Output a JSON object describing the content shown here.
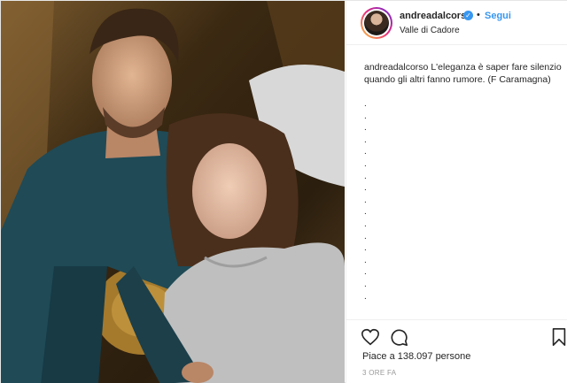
{
  "post": {
    "username": "andreadalcorso",
    "verified_icon": "verified-badge-icon",
    "separator": "•",
    "follow_label": "Segui",
    "location": "Valle di Cadore",
    "caption_user": "andreadalcorso",
    "caption_text": "L'eleganza è saper fare silenzio quando gli altri fanno rumore. (F Caramagna)",
    "caption_dots": [
      ".",
      ".",
      ".",
      ".",
      ".",
      ".",
      ".",
      ".",
      ".",
      ".",
      ".",
      ".",
      ".",
      ".",
      ".",
      ".",
      "."
    ],
    "likes": "Piace a 138.097 persone",
    "timestamp": "3 ORE FA"
  },
  "icons": {
    "like": "heart-icon",
    "comment": "comment-icon",
    "save": "bookmark-icon"
  },
  "colors": {
    "link_blue": "#3897f0",
    "text": "#262626",
    "muted": "#999999"
  }
}
